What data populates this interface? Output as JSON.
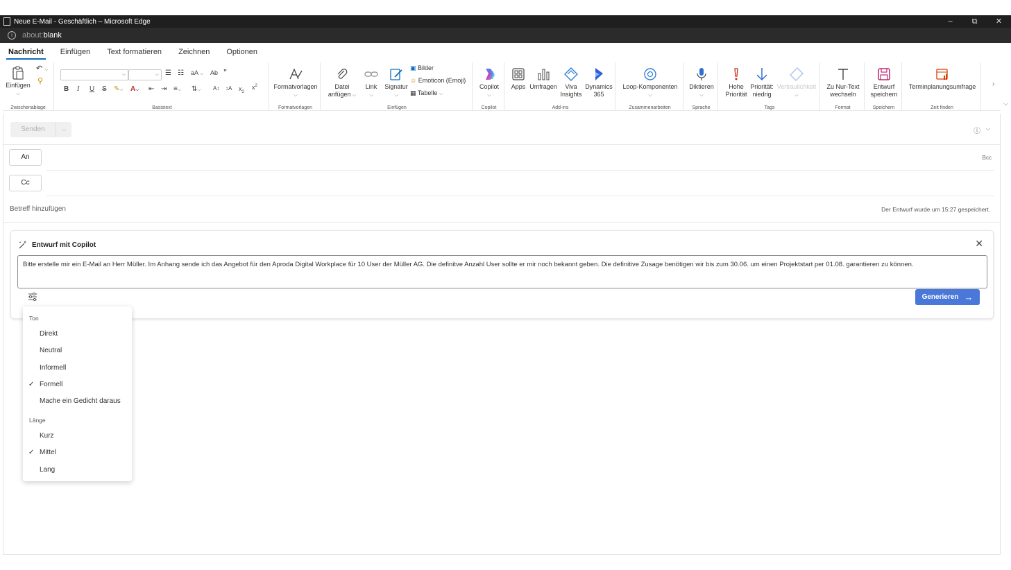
{
  "window": {
    "title": "Neue E-Mail - Geschäftlich – Microsoft Edge",
    "url_prefix": "about:",
    "url_main": "blank",
    "minimize": "–",
    "restore": "⧉",
    "close": "✕"
  },
  "tabs": [
    {
      "label": "Nachricht",
      "active": true
    },
    {
      "label": "Einfügen"
    },
    {
      "label": "Text formatieren"
    },
    {
      "label": "Zeichnen"
    },
    {
      "label": "Optionen"
    }
  ],
  "ribbon": {
    "clipboard": {
      "paste": "Einfügen",
      "group": "Zwischenablage"
    },
    "basictext": {
      "group": "Basistext"
    },
    "styles": {
      "label": "Formatvorlagen",
      "group": "Formatvorlagen"
    },
    "insert": {
      "attach1": "Datei",
      "attach2": "anfügen",
      "link": "Link",
      "signature": "Signatur",
      "pictures": "Bilder",
      "emoticon": "Emoticon (Emoji)",
      "table": "Tabelle",
      "group": "Einfügen"
    },
    "copilot": {
      "label": "Copilot",
      "group": "Copilot"
    },
    "addins": {
      "apps": "Apps",
      "polls": "Umfragen",
      "viva1": "Viva",
      "viva2": "Insights",
      "dyn1": "Dynamics",
      "dyn2": "365",
      "group": "Add-ins"
    },
    "collab": {
      "loop": "Loop-Komponenten",
      "group": "Zusammenarbeiten"
    },
    "voice": {
      "dictate": "Diktieren",
      "group": "Sprache"
    },
    "tags": {
      "high1": "Hohe",
      "high2": "Priorität",
      "low1": "Priorität:",
      "low2": "niedrig",
      "sensitivity": "Vertraulichkeit",
      "group": "Tags"
    },
    "format": {
      "plain1": "Zu Nur-Text",
      "plain2": "wechseln",
      "group": "Format"
    },
    "save": {
      "draft1": "Entwurf",
      "draft2": "speichern",
      "group": "Speichern"
    },
    "findtime": {
      "poll": "Terminplanungsumfrage",
      "group": "Zeit finden"
    }
  },
  "compose": {
    "send": "Senden",
    "to": "An",
    "cc": "Cc",
    "bcc": "Bcc",
    "subject_placeholder": "Betreff hinzufügen",
    "saved_status": "Der Entwurf wurde um 15:27 gespeichert."
  },
  "copilot_card": {
    "title": "Entwurf mit Copilot",
    "prompt": "Bitte erstelle mir ein E-Mail an Herr Müller. Im Anhang sende ich das Angebot für den Aproda Digital Workplace für 10 User der Müller AG. Die definitve Anzahl User sollte er mir noch bekannt geben. Die definitive Zusage benötigen wir bis zum 30.06. um einen Projektstart per 01.08. garantieren zu können.",
    "generate": "Generieren"
  },
  "menu": {
    "tone_header": "Ton",
    "tone": [
      {
        "label": "Direkt",
        "checked": false
      },
      {
        "label": "Neutral",
        "checked": false
      },
      {
        "label": "Informell",
        "checked": false
      },
      {
        "label": "Formell",
        "checked": true
      },
      {
        "label": "Mache ein Gedicht daraus",
        "checked": false
      }
    ],
    "length_header": "Länge",
    "length": [
      {
        "label": "Kurz",
        "checked": false
      },
      {
        "label": "Mittel",
        "checked": true
      },
      {
        "label": "Lang",
        "checked": false
      }
    ],
    "checkmark": "✓"
  },
  "colors": {
    "accent": "#0f6cbd",
    "generate_button": "#4a78d8",
    "titlebar": "#1f1f1f",
    "copilot_gradient": [
      "#2aa0f2",
      "#c43bd4",
      "#f5a623"
    ]
  }
}
